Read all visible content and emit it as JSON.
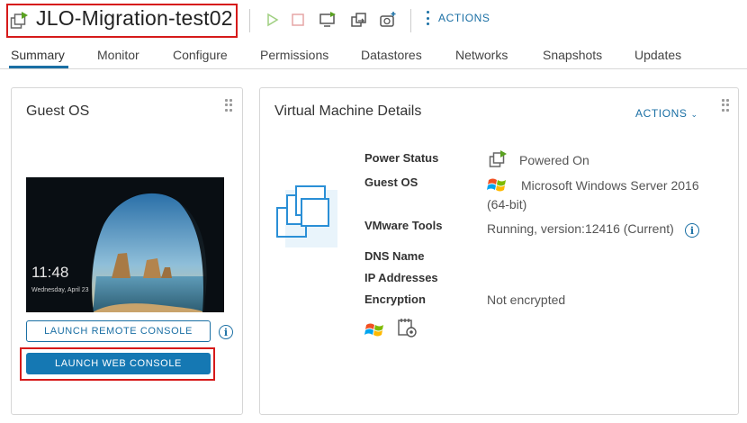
{
  "header": {
    "vm_name": "JLO-Migration-test02",
    "actions_label": "ACTIONS"
  },
  "tabs": [
    {
      "label": "Summary",
      "active": true
    },
    {
      "label": "Monitor"
    },
    {
      "label": "Configure"
    },
    {
      "label": "Permissions"
    },
    {
      "label": "Datastores"
    },
    {
      "label": "Networks"
    },
    {
      "label": "Snapshots"
    },
    {
      "label": "Updates"
    }
  ],
  "guest_os_card": {
    "title": "Guest OS",
    "console_time": "11:48",
    "console_date": "Wednesday, April 23",
    "launch_remote_label": "LAUNCH REMOTE CONSOLE",
    "launch_web_label": "LAUNCH WEB CONSOLE"
  },
  "vm_details_card": {
    "title": "Virtual Machine Details",
    "actions_label": "ACTIONS",
    "fields": {
      "power_status_label": "Power Status",
      "power_status_value": "Powered On",
      "guest_os_label": "Guest OS",
      "guest_os_value_line1": "Microsoft Windows Server 2016",
      "guest_os_value_line2": "(64-bit)",
      "vmware_tools_label": "VMware Tools",
      "vmware_tools_value": "Running, version:12416 (Current)",
      "dns_name_label": "DNS Name",
      "ip_addresses_label": "IP Addresses",
      "encryption_label": "Encryption",
      "encryption_value": "Not encrypted"
    }
  },
  "colors": {
    "accent": "#1a6fa4",
    "highlight_border": "#d61a1a",
    "power_on_green": "#5aa220"
  },
  "icons": [
    "vm-icon",
    "power-on-icon",
    "power-off-icon",
    "open-console-icon",
    "migrate-icon",
    "new-snapshot-icon",
    "kebab-icon",
    "grip-icon",
    "info-icon",
    "vm-large-icon",
    "windows-logo-icon",
    "vmware-tools-icon"
  ]
}
